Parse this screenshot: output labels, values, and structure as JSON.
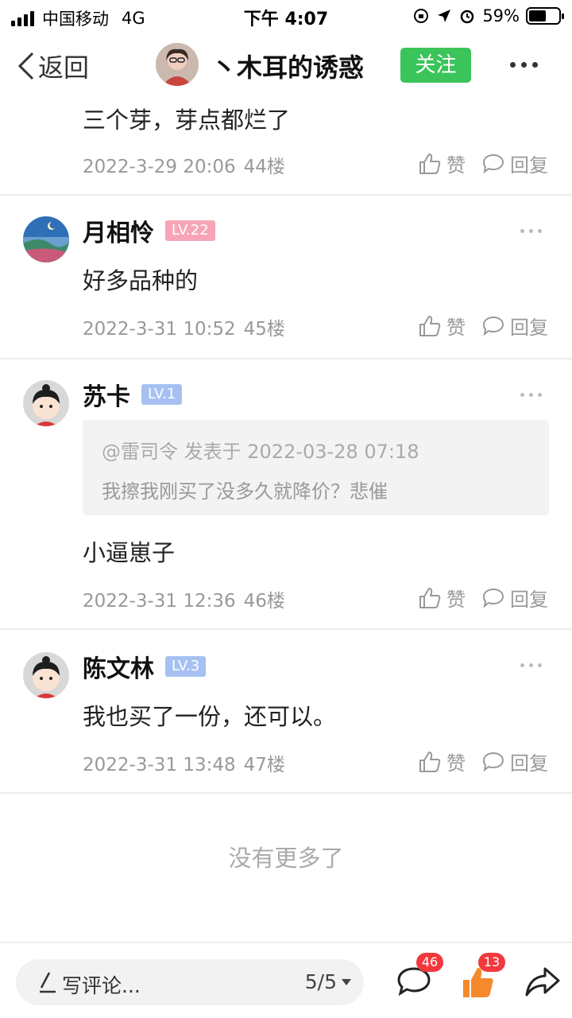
{
  "status_bar": {
    "carrier": "中国移动",
    "network": "4G",
    "time": "下午 4:07",
    "battery_percent": "59%",
    "battery_level": 0.59
  },
  "nav": {
    "back_label": "返回",
    "title": "丶木耳的诱惑",
    "follow_label": "关注"
  },
  "comments": [
    {
      "text": "三个芽，芽点都烂了",
      "date": "2022-3-29 20:06",
      "floor": "44楼",
      "like_label": "赞",
      "reply_label": "回复"
    },
    {
      "name": "月相怜",
      "level": "LV.22",
      "text": "好多品种的",
      "date": "2022-3-31 10:52",
      "floor": "45楼",
      "like_label": "赞",
      "reply_label": "回复"
    },
    {
      "name": "苏卡",
      "level": "LV.1",
      "quote_header": "@雷司令 发表于 2022-03-28 07:18",
      "quote_text": "我擦我刚买了没多久就降价？悲催",
      "text": "小逼崽子",
      "date": "2022-3-31 12:36",
      "floor": "46楼",
      "like_label": "赞",
      "reply_label": "回复"
    },
    {
      "name": "陈文林",
      "level": "LV.3",
      "text": "我也买了一份，还可以。",
      "date": "2022-3-31 13:48",
      "floor": "47楼",
      "like_label": "赞",
      "reply_label": "回复"
    }
  ],
  "no_more": "没有更多了",
  "bottom_bar": {
    "compose_placeholder": "写评论...",
    "page_indicator": "5/5",
    "comment_count": "46",
    "like_count": "13"
  },
  "colors": {
    "follow_green": "#3bc45a",
    "badge_red": "#f2393d",
    "like_orange": "#f5892b",
    "level_pink": "#f7a5b6",
    "level_blue": "#a6c1f1"
  }
}
